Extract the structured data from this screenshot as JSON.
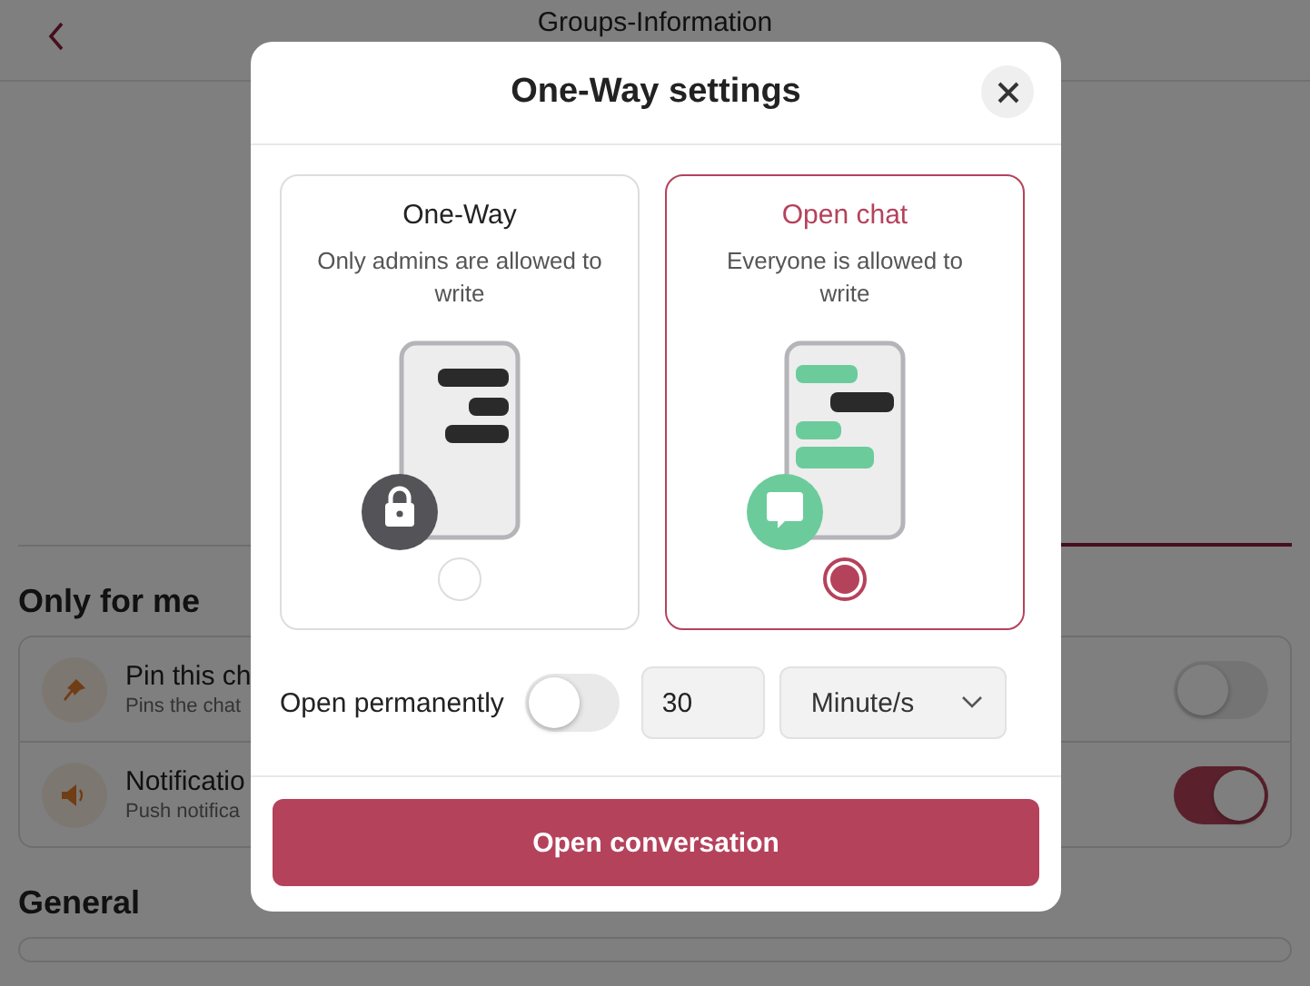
{
  "header": {
    "title": "Groups-Information"
  },
  "sections": [
    {
      "title": "Only for me",
      "rows": [
        {
          "kind": "pin",
          "title": "Pin this ch",
          "subtitle": "Pins the chat",
          "on": false
        },
        {
          "kind": "notification",
          "title": "Notificatio",
          "subtitle": "Push notifica",
          "on": true
        }
      ]
    },
    {
      "title": "General"
    }
  ],
  "dialog": {
    "title": "One-Way settings",
    "options": [
      {
        "kind": "one-way",
        "title": "One-Way",
        "description": "Only admins are allowed to write",
        "selected": false
      },
      {
        "kind": "open",
        "title": "Open chat",
        "description": "Everyone is allowed to write",
        "selected": true
      }
    ],
    "permanent": {
      "label": "Open permanently",
      "on": false
    },
    "duration": {
      "value": "30"
    },
    "unit": {
      "value": "Minute/s"
    },
    "submit": "Open conversation"
  }
}
